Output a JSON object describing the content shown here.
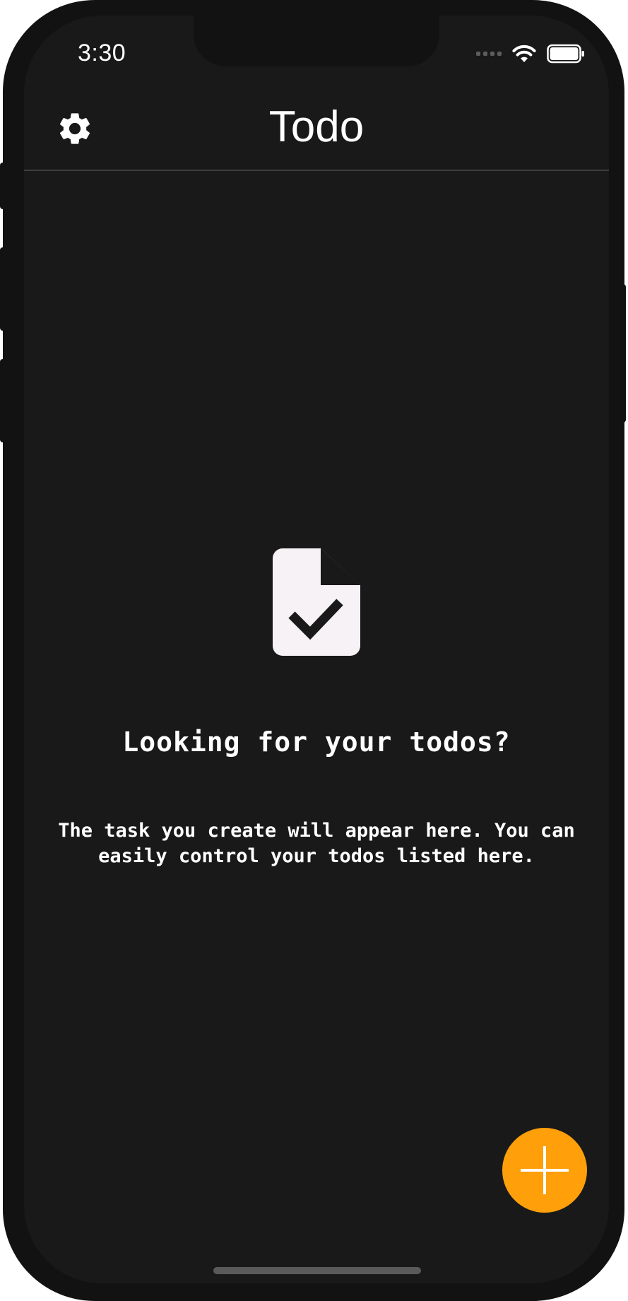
{
  "status_bar": {
    "time": "3:30"
  },
  "header": {
    "title": "Todo",
    "settings_icon": "gear-icon"
  },
  "empty_state": {
    "icon": "document-check-icon",
    "title": "Looking for your todos?",
    "description": "The task you create will appear here. You can easily control your todos listed here."
  },
  "fab": {
    "icon": "plus-icon"
  },
  "colors": {
    "background": "#191919",
    "device_frame": "#121212",
    "accent": "#ff9f0a",
    "text": "#ffffff",
    "icon_fill": "#f7f2f5"
  }
}
